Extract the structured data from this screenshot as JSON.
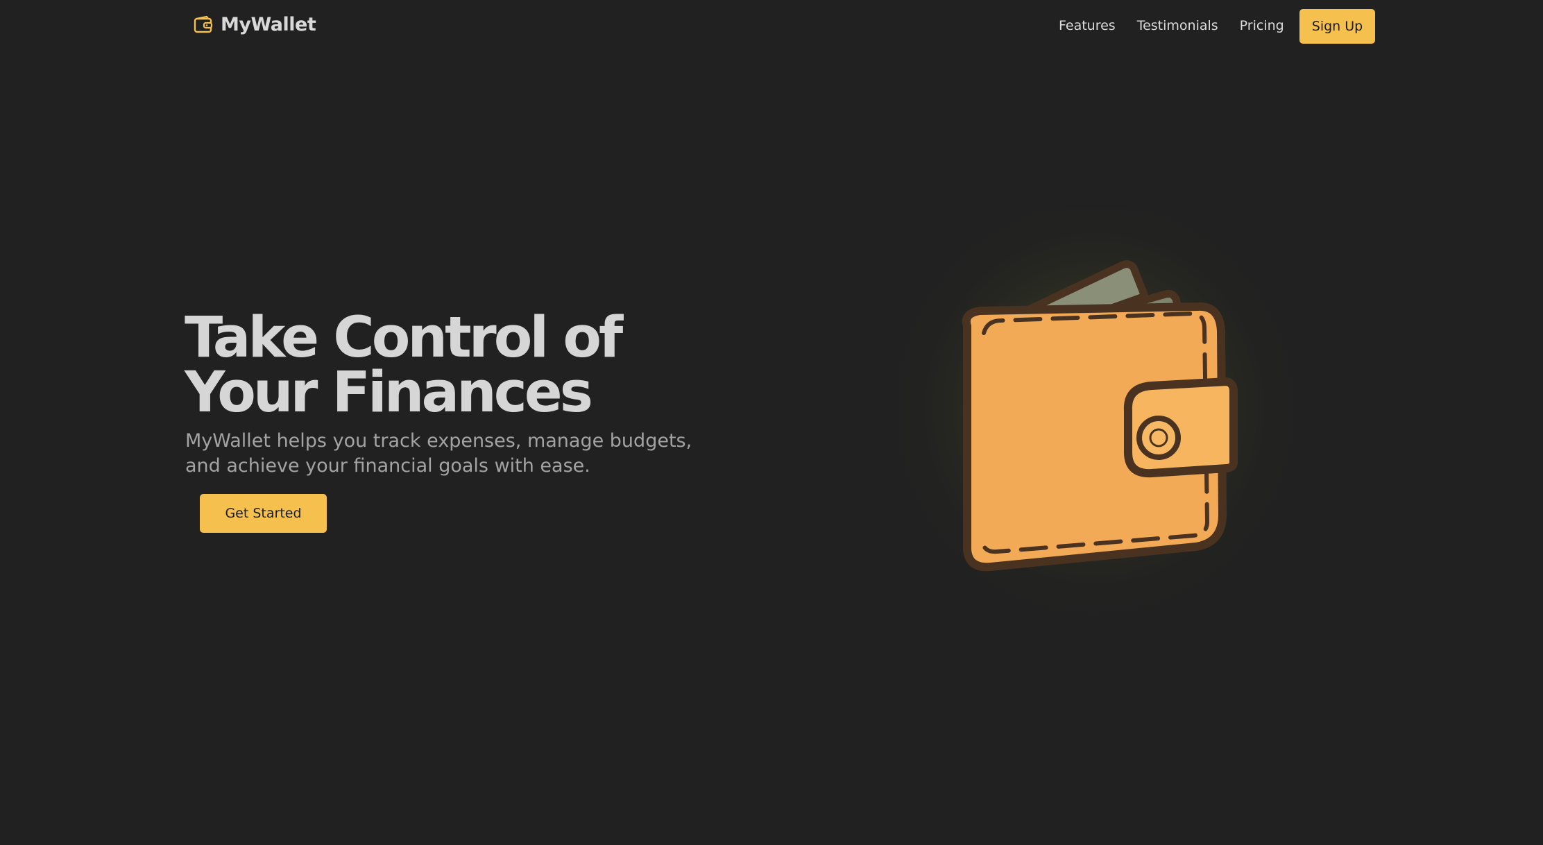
{
  "header": {
    "brand_name": "MyWallet",
    "brand_icon": "wallet-icon",
    "nav": [
      {
        "label": "Features"
      },
      {
        "label": "Testimonials"
      },
      {
        "label": "Pricing"
      }
    ],
    "signup_label": "Sign Up"
  },
  "hero": {
    "title": "Take Control of Your Finances",
    "subtitle": "MyWallet helps you track expenses, manage budgets, and achieve your financial goals with ease.",
    "cta_label": "Get Started",
    "illustration_icon": "wallet-illustration-icon"
  },
  "colors": {
    "background": "#212121",
    "accent": "#f6c04f",
    "wallet_body": "#f2aa57",
    "wallet_outline": "#4a3220",
    "cash": "#8a8f78"
  }
}
